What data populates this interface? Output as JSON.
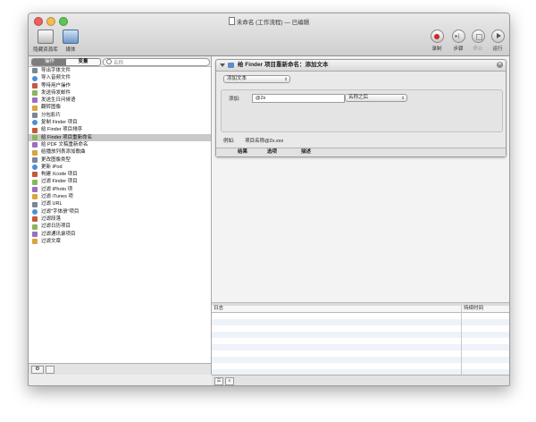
{
  "window": {
    "title": "未命名 (工作流程) — 已编辑"
  },
  "toolbar": {
    "library_label": "隐藏资源库",
    "media_label": "媒体",
    "record_label": "录制",
    "step_label": "步骤",
    "stop_label": "停止",
    "run_label": "运行"
  },
  "library": {
    "tab_actions": "操作",
    "tab_variables": "变量",
    "search_placeholder": "名称",
    "items": [
      "导出字体文件",
      "导入音频文件",
      "等待用户操作",
      "发送待发邮件",
      "发送生日问候语",
      "翻转图像",
      "分包影片",
      "复制 Finder 项目",
      "给 Finder 项目排序",
      "给 Finder 项目重新命名",
      "给 PDF 文稿重新命名",
      "给播放列表添加歌曲",
      "更改图像类型",
      "更新 iPod",
      "构建 Xcode 项目",
      "过滤 Finder 项目",
      "过滤 iPhoto 项",
      "过滤 iTunes 项",
      "过滤 URL",
      "过滤\"字体册\"项目",
      "过滤段落",
      "过滤日历项目",
      "过滤通讯录项目",
      "过滤文章"
    ],
    "selected_index": 9
  },
  "action_card": {
    "title": "给 Finder 项目重新命名：添加文本",
    "mode_dropdown": "添加文本",
    "add_label": "添加:",
    "add_value": "@2x",
    "position_dropdown": "名称之后",
    "example_label": "例如:",
    "example_value": "项目名称@2x.xxx",
    "tabs": [
      "结果",
      "选项",
      "描述"
    ]
  },
  "log": {
    "col_log": "日志",
    "col_duration": "持续时间"
  }
}
